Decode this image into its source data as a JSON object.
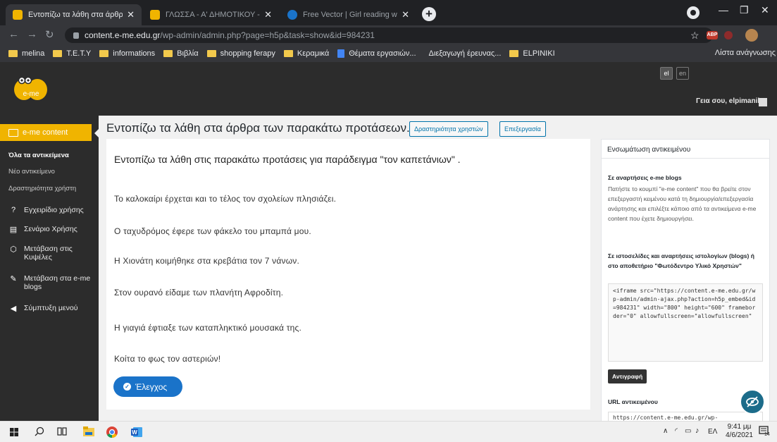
{
  "browser": {
    "tabs": [
      {
        "title": "Εντοπίζω τα λάθη στα άρθρα τ",
        "active": true,
        "fav_color": "#f0b400"
      },
      {
        "title": "ΓΛΩΣΣΑ - Α' ΔΗΜΟΤΙΚΟΥ - ΕΙΔΙΚ",
        "active": false,
        "fav_color": "#f0b400"
      },
      {
        "title": "Free Vector | Girl reading while w",
        "active": false,
        "fav_color": "#1a73c9"
      }
    ],
    "new_tab_symbol": "+",
    "url_host": "content.e-me.edu.gr",
    "url_path": "/wp-admin/admin.php?page=h5p&task=show&id=984231",
    "bookmarks": [
      {
        "label": "melina",
        "icon": "folder"
      },
      {
        "label": "T.E.T.Y",
        "icon": "folder"
      },
      {
        "label": "informations",
        "icon": "folder"
      },
      {
        "label": "Βιβλία",
        "icon": "folder"
      },
      {
        "label": "shopping ferapy",
        "icon": "folder"
      },
      {
        "label": "Κεραμικά",
        "icon": "folder"
      },
      {
        "label": "Θέματα εργασιών...",
        "icon": "doc"
      },
      {
        "label": "Διεξαγωγή έρευνας...",
        "icon": "none"
      },
      {
        "label": "ELPINIKI",
        "icon": "folder"
      }
    ],
    "reading_list": "Λίστα ανάγνωσης",
    "extension_abp": "ABP"
  },
  "wp_topbar": {
    "logo_text": "e-me",
    "lang_el": "el",
    "lang_en": "en",
    "greeting": "Γεια σου, elpimanika"
  },
  "sidebar": {
    "main_item": "e-me content",
    "sub_items": [
      "Όλα τα αντικείμενα",
      "Νέο αντικείμενο",
      "Δραστηριότητα χρήστη"
    ],
    "items": [
      {
        "label": "Εγχειρίδιο χρήσης",
        "icon": "help-circle-icon",
        "glyph": "?"
      },
      {
        "label": "Σενάριο Χρήσης",
        "icon": "document-icon",
        "glyph": "▤"
      },
      {
        "label": "Μετάβαση στις Κυψέλες",
        "icon": "hexagon-icon",
        "glyph": "⬡"
      },
      {
        "label": "Μετάβαση στα e-me blogs",
        "icon": "pen-icon",
        "glyph": "✎"
      },
      {
        "label": "Σύμπτυξη μενού",
        "icon": "collapse-arrow-icon",
        "glyph": "◀"
      }
    ]
  },
  "page": {
    "title": "Εντοπίζω τα λάθη στα άρθρα των παρακάτω προτάσεων.",
    "btn_activity": "Δραστηριότητα χρηστών",
    "btn_edit": "Επεξεργασία"
  },
  "activity": {
    "instruction": "Εντοπίζω τα λάθη στις παρακάτω προτάσεις για παράδειγμα \"τον καπετάνιων\" .",
    "sentences": [
      "Το καλοκαίρι έρχεται και το τέλος τον σχολείων πλησιάζει.",
      "Ο ταχυδρόμος έφερε των φάκελο του μπαμπά μου.",
      "Η Χιονάτη κοιμήθηκε στα κρεβάτια τον 7 νάνων.",
      "Στον ουρανό είδαμε των πλανήτη Αφροδίτη.",
      "Η γιαγιά έφτιαξε των καταπληκτικό μουσακά της.",
      "Κοίτα το φως τον αστεριών!"
    ],
    "check_button": "Έλεγχος"
  },
  "embed_panel": {
    "heading": "Ενσωμάτωση αντικειμένου",
    "blogs_title": "Σε αναρτήσεις e-me blogs",
    "blogs_text": "Πατήστε το κουμπί \"e-me content\" που θα βρείτε στον επεξεργαστή κειμένου κατά τη δημιουργία/επεξεργασία ανάρτησης και επιλέξτε κάποιο από τα αντικείμενα e-me content που έχετε δημιουργήσει.",
    "sites_title": "Σε ιστοσελίδες και αναρτήσεις ιστολογίων (blogs) ή στο αποθετήριο \"Φωτόδεντρο Υλικό Χρηστών\"",
    "embed_code": "<iframe src=\"https://content.e-me.edu.gr/wp-admin/admin-ajax.php?action=h5p_embed&id=984231\" width=\"800\" height=\"600\" frameborder=\"0\" allowfullscreen=\"allowfullscreen\"",
    "copy_button": "Αντιγραφή",
    "url_title": "URL αντικειμένου",
    "url_value": "https://content.e-me.edu.gr/wp-"
  },
  "taskbar": {
    "tray_lang": "ΕΛ",
    "time": "9:41 μμ",
    "date": "4/6/2021",
    "notifications": "14"
  }
}
